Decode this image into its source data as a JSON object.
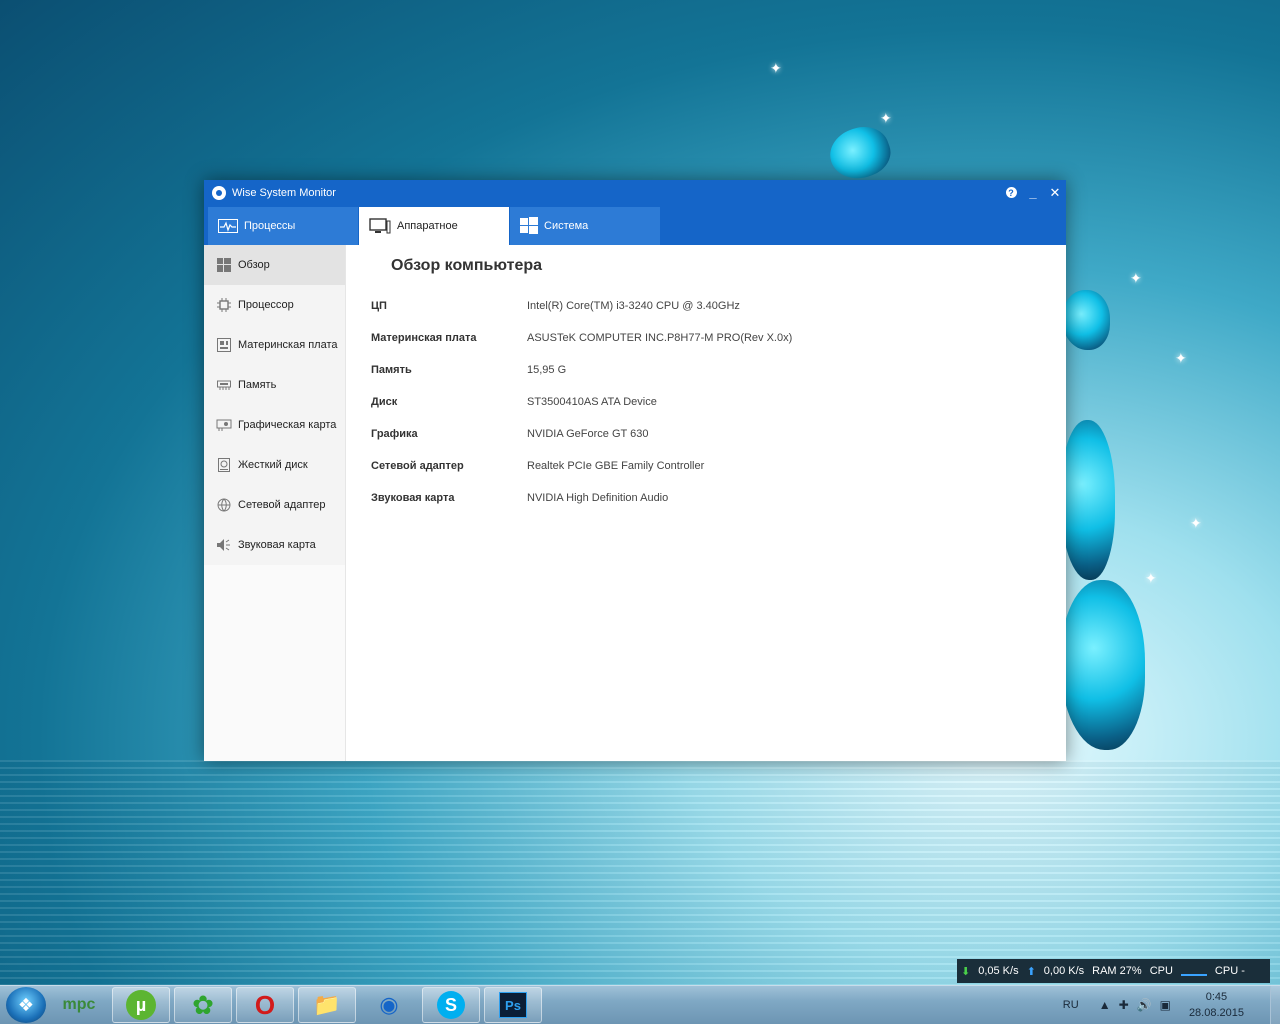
{
  "window": {
    "title": "Wise System Monitor",
    "controls": {
      "help": "?",
      "minimize": "_",
      "close": "✕"
    }
  },
  "tabs": [
    {
      "label": "Процессы",
      "icon": "activity-icon",
      "active": false
    },
    {
      "label": "Аппаратное",
      "icon": "monitor-icon",
      "active": true
    },
    {
      "label": "Система",
      "icon": "windows-icon",
      "active": false
    }
  ],
  "sidebar": {
    "items": [
      {
        "label": "Обзор",
        "icon": "windows-icon",
        "active": true
      },
      {
        "label": "Процессор",
        "icon": "cpu-icon"
      },
      {
        "label": "Материнская плата",
        "icon": "motherboard-icon"
      },
      {
        "label": "Память",
        "icon": "memory-icon"
      },
      {
        "label": "Графическая карта",
        "icon": "graphics-card-icon"
      },
      {
        "label": "Жесткий диск",
        "icon": "hard-disk-icon"
      },
      {
        "label": "Сетевой адаптер",
        "icon": "network-icon"
      },
      {
        "label": "Звуковая карта",
        "icon": "speaker-icon"
      }
    ]
  },
  "overview": {
    "title": "Обзор компьютера",
    "rows": [
      {
        "label": "ЦП",
        "value": "Intel(R) Core(TM) i3-3240 CPU @ 3.40GHz"
      },
      {
        "label": "Материнская плата",
        "value": "ASUSTeK COMPUTER INC.P8H77-M PRO(Rev X.0x)"
      },
      {
        "label": "Память",
        "value": "15,95 G"
      },
      {
        "label": "Диск",
        "value": "ST3500410AS ATA Device"
      },
      {
        "label": "Графика",
        "value": "NVIDIA GeForce GT 630"
      },
      {
        "label": "Сетевой адаптер",
        "value": "Realtek PCIe GBE Family Controller"
      },
      {
        "label": "Звуковая карта",
        "value": "NVIDIA High Definition Audio"
      }
    ]
  },
  "netmon": {
    "down_speed": "0,05 K/s",
    "up_speed": "0,00 K/s",
    "ram": "RAM 27%",
    "cpu_label": "CPU",
    "cpu2": "CPU -"
  },
  "taskbar": {
    "apps": [
      {
        "name": "mpc",
        "label": "mpc"
      },
      {
        "name": "utorrent",
        "label": "µ"
      },
      {
        "name": "icq",
        "label": "✿"
      },
      {
        "name": "opera",
        "label": "O"
      },
      {
        "name": "explorer",
        "label": "📁"
      },
      {
        "name": "wise",
        "label": "◉"
      },
      {
        "name": "skype",
        "label": "S"
      },
      {
        "name": "photoshop",
        "label": "Ps"
      }
    ],
    "lang": "RU",
    "time": "0:45",
    "date": "28.08.2015"
  },
  "colors": {
    "accent": "#1565c8",
    "tab_inactive": "#2d7bd6",
    "sidebar_bg": "#f4f4f4"
  }
}
